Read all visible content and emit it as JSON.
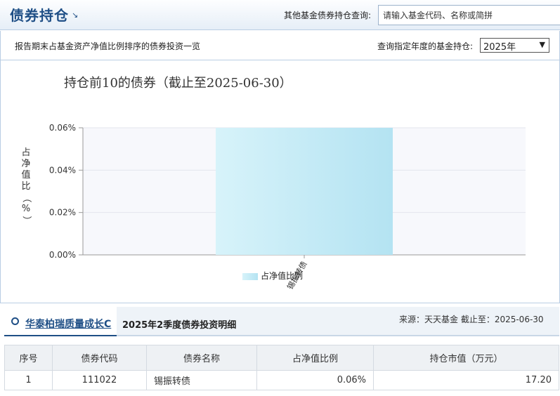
{
  "header": {
    "title": "债券持仓",
    "title_arrow": "↘",
    "search_label": "其他基金债券持仓查询:",
    "search_placeholder": "请输入基金代码、名称或简拼"
  },
  "subbar": {
    "description": "报告期末占基金资产净值比例排序的债券投资一览",
    "year_label": "查询指定年度的基金持仓:",
    "year_selected": "2025年"
  },
  "chart_data": {
    "type": "bar",
    "title": "持仓前10的债券（截止至2025-06-30）",
    "ylabel": "占净值比（%）",
    "categories": [
      "锡振转债"
    ],
    "series": [
      {
        "name": "占净值比例",
        "values": [
          0.06
        ]
      }
    ],
    "ylim": [
      0,
      0.06
    ],
    "yticks": [
      "0.00%",
      "0.02%",
      "0.04%",
      "0.06%"
    ],
    "grid": true,
    "legend": "bottom",
    "colors": {
      "bar_light": "#d7f3fa",
      "bar_dark": "#b4e3f2",
      "plot_bg": "#f7f8fc"
    }
  },
  "detail": {
    "fund_name": "华泰柏瑞质量成长C",
    "title": "2025年2季度债券投资明细",
    "source": "来源：天天基金    截止至：2025-06-30",
    "columns": [
      "序号",
      "债券代码",
      "债券名称",
      "占净值比例",
      "持仓市值（万元）"
    ],
    "rows": [
      {
        "no": "1",
        "code": "111022",
        "name": "锡振转债",
        "ratio": "0.06%",
        "value": "17.20"
      }
    ]
  },
  "colors": {
    "brand": "#1f4f86",
    "border": "#b9cde3"
  }
}
